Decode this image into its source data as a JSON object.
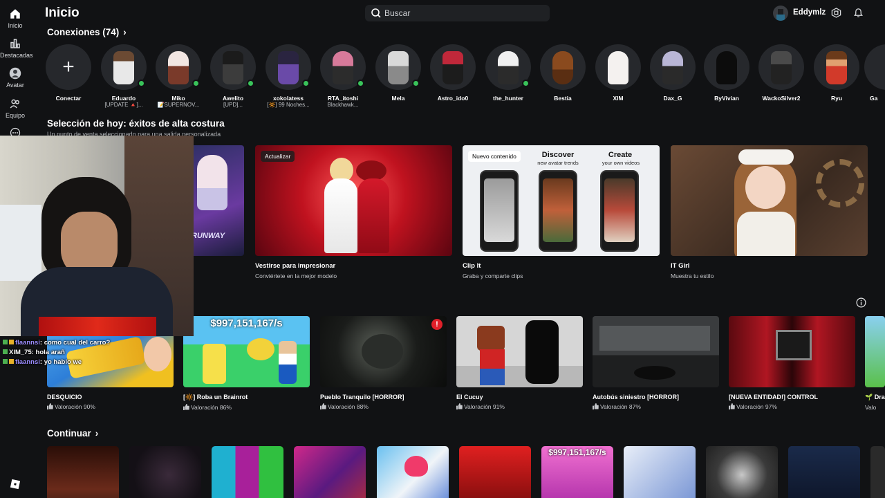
{
  "sidebar": {
    "items": [
      {
        "label": "Inicio",
        "icon": "home-icon"
      },
      {
        "label": "Destacadas",
        "icon": "chart-icon"
      },
      {
        "label": "Avatar",
        "icon": "avatar-icon"
      },
      {
        "label": "Equipo",
        "icon": "group-icon"
      }
    ]
  },
  "header": {
    "title": "Inicio",
    "search_placeholder": "Buscar",
    "username": "Eddymlz"
  },
  "connections": {
    "title": "Conexiones (74)",
    "add_label": "Conectar",
    "items": [
      {
        "name": "Eduardo",
        "status": "[UPDATE 🔺]...",
        "online": true
      },
      {
        "name": "Miko",
        "status": "📝SUPERNOV...",
        "online": true
      },
      {
        "name": "Awelito",
        "status": "[UPD]...",
        "online": true
      },
      {
        "name": "xokolatess",
        "status": "[🔆] 99 Noches...",
        "online": true
      },
      {
        "name": "RTA_itoshi",
        "status": "Blackhawk...",
        "online": true
      },
      {
        "name": "Mela",
        "status": "",
        "online": true
      },
      {
        "name": "Astro_ido0",
        "status": "",
        "online": false
      },
      {
        "name": "the_hunter",
        "status": "",
        "online": true
      },
      {
        "name": "Bestia",
        "status": "",
        "online": false
      },
      {
        "name": "XIM",
        "status": "",
        "online": false
      },
      {
        "name": "Dax_G",
        "status": "",
        "online": false
      },
      {
        "name": "ByVivian",
        "status": "",
        "online": false
      },
      {
        "name": "WackoSilver2",
        "status": "",
        "online": false
      },
      {
        "name": "Ryu",
        "status": "",
        "online": false
      },
      {
        "name": "Ga",
        "status": "",
        "online": false
      }
    ]
  },
  "featured": {
    "title": "Selección de hoy: éxitos de alta costura",
    "subtitle": "Un punto de venta seleccionado para una salida personalizada",
    "cards": [
      {
        "title": "Vestirse para impresionar",
        "subtitle": "Conviértete en la mejor modelo",
        "badge": "Actualizar"
      },
      {
        "title": "Clip It",
        "subtitle": "Graba y comparte clips",
        "badge": "Nuevo contenido",
        "promo_left": "Discover",
        "promo_left_sub": "new avatar trends",
        "promo_right": "Create",
        "promo_right_sub": "your own videos"
      },
      {
        "title": "IT Girl",
        "subtitle": "Muestra tu estilo",
        "badge": ""
      }
    ],
    "partial_logo": "RUNWAY"
  },
  "games": {
    "items": [
      {
        "name": "DESQUICIO",
        "rating": "Valoración 90%"
      },
      {
        "name": "[🔆] Roba un Brainrot",
        "rating": "Valoración 86%",
        "overlay": "$997,151,167/s"
      },
      {
        "name": "Pueblo Tranquilo [HORROR]",
        "rating": "Valoración 88%"
      },
      {
        "name": "El Cucuy",
        "rating": "Valoración 91%"
      },
      {
        "name": "Autobús siniestro [HORROR]",
        "rating": "Valoración 87%"
      },
      {
        "name": "[NUEVA ENTIDAD!] CONTROL",
        "rating": "Valoración 97%"
      },
      {
        "name": "🌱 Dra",
        "rating": "Valo"
      }
    ]
  },
  "continue": {
    "title": "Continuar",
    "overlay": "$997,151,167/s"
  },
  "chat": [
    {
      "user": "flaannsi",
      "message": ": como cual del carro?"
    },
    {
      "user": "XIM_75",
      "message": ": hola arañ"
    },
    {
      "user": "flaannsi",
      "message": ": yo hablo we"
    }
  ],
  "colors": {
    "background": "#111214",
    "online": "#39c35a",
    "text_secondary": "#c6c8cc"
  }
}
